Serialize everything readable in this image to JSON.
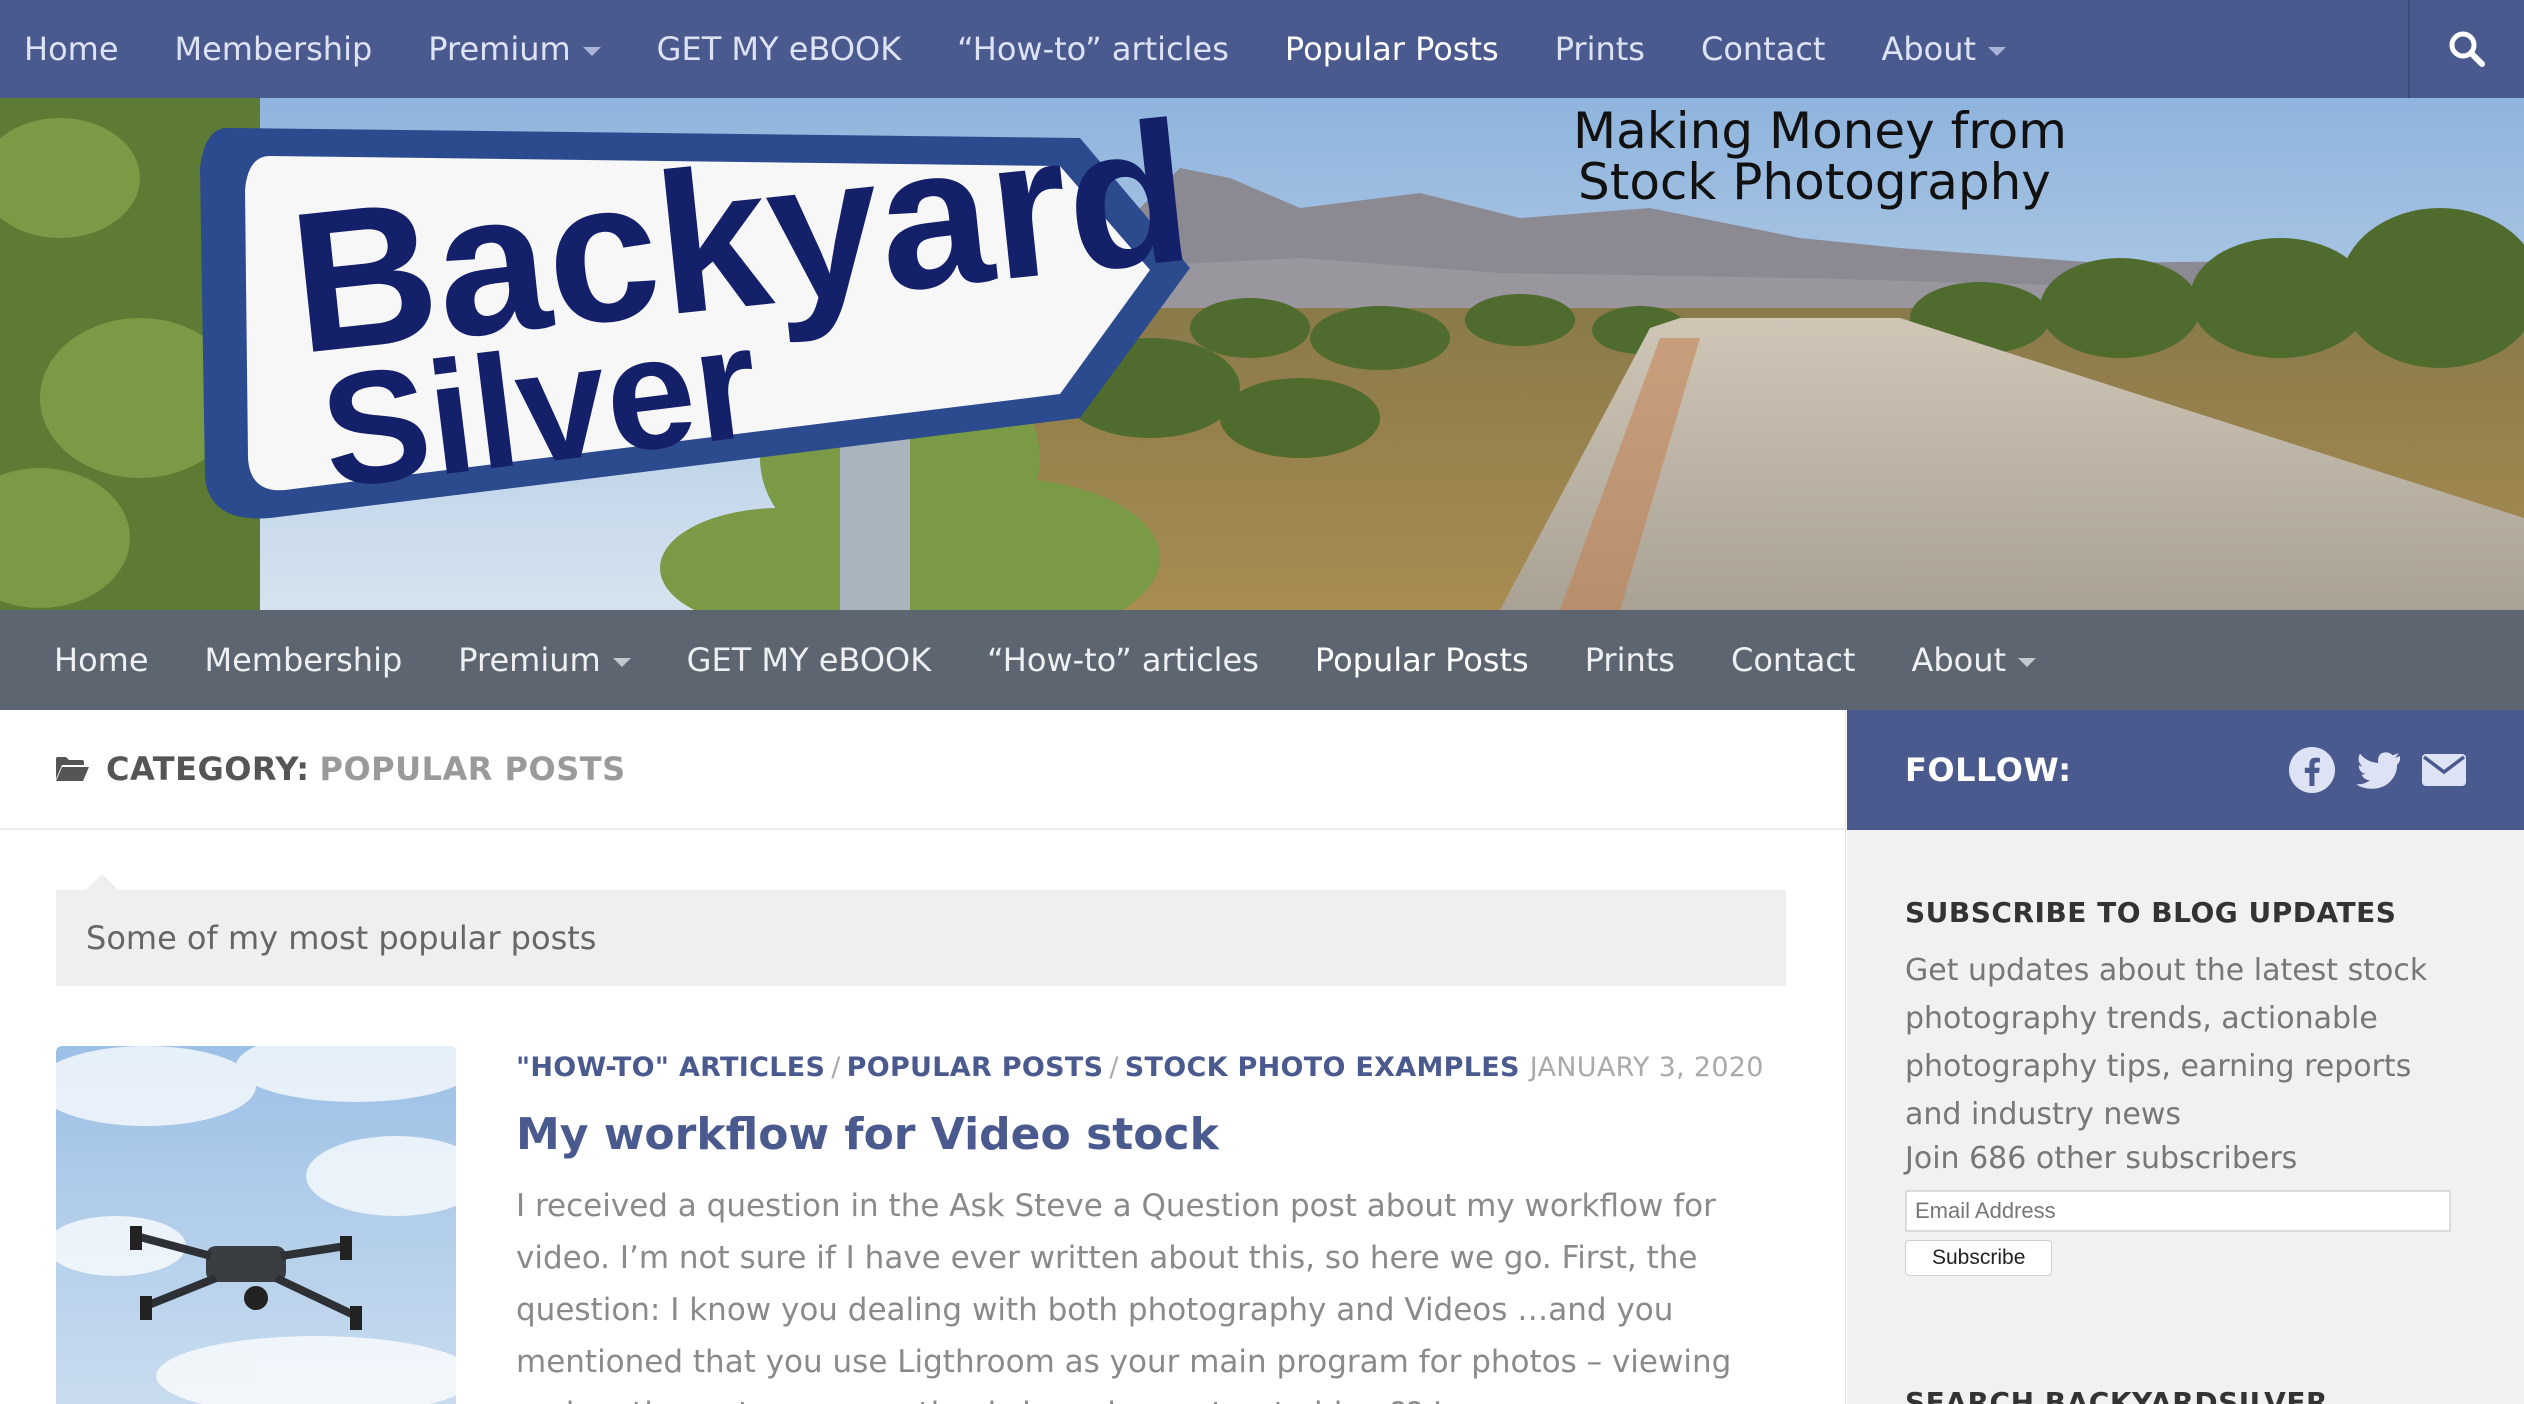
{
  "top_nav": {
    "items": [
      {
        "label": "Home",
        "has_dropdown": false
      },
      {
        "label": "Membership",
        "has_dropdown": false
      },
      {
        "label": "Premium",
        "has_dropdown": true
      },
      {
        "label": "GET MY eBOOK",
        "has_dropdown": false
      },
      {
        "label": "“How-to” articles",
        "has_dropdown": false
      },
      {
        "label": "Popular Posts",
        "has_dropdown": false,
        "active": true
      },
      {
        "label": "Prints",
        "has_dropdown": false
      },
      {
        "label": "Contact",
        "has_dropdown": false
      },
      {
        "label": "About",
        "has_dropdown": true
      }
    ],
    "search_icon": "search-icon"
  },
  "banner": {
    "logo_line1": "Backyard",
    "logo_line2": "Silver",
    "tagline_line1": "Making Money from",
    "tagline_line2": "Stock Photography"
  },
  "sub_nav": {
    "items": [
      {
        "label": "Home",
        "has_dropdown": false
      },
      {
        "label": "Membership",
        "has_dropdown": false
      },
      {
        "label": "Premium",
        "has_dropdown": true
      },
      {
        "label": "GET MY eBOOK",
        "has_dropdown": false
      },
      {
        "label": "“How-to” articles",
        "has_dropdown": false
      },
      {
        "label": "Popular Posts",
        "has_dropdown": false,
        "active": true
      },
      {
        "label": "Prints",
        "has_dropdown": false
      },
      {
        "label": "Contact",
        "has_dropdown": false
      },
      {
        "label": "About",
        "has_dropdown": true
      }
    ]
  },
  "category": {
    "icon": "folder-open-icon",
    "label": "CATEGORY:",
    "value": "POPULAR POSTS",
    "description": "Some of my most popular posts"
  },
  "post": {
    "categories": [
      "\"HOW-TO\" ARTICLES",
      "POPULAR POSTS",
      "STOCK PHOTO EXAMPLES"
    ],
    "separator": "/",
    "date": "JANUARY 3, 2020",
    "title": "My workflow for Video stock",
    "excerpt": "I received a question in the Ask Steve a Question post about my workflow for video. I’m not sure if I have ever written about this, so here we go. First, the question: I know you dealing with both photography and Videos …and you mentioned that you use Ligthroom as your main program for photos – viewing and sorting ect – my question is how do you treat video ?? I",
    "thumbnail_icon": "drone-photo"
  },
  "sidebar": {
    "follow_label": "FOLLOW:",
    "social_icons": [
      "facebook-icon",
      "twitter-icon",
      "email-icon"
    ],
    "subscribe": {
      "title": "SUBSCRIBE TO BLOG UPDATES",
      "text": "Get updates about the latest stock photography trends, actionable photography tips, earning reports and industry news",
      "join": "Join 686 other subscribers",
      "email_placeholder": "Email Address",
      "button": "Subscribe"
    },
    "search_title": "SEARCH BACKYARDSILVER"
  },
  "colors": {
    "nav_blue": "#4b5a8e",
    "nav_grey": "#5d6670",
    "sidebar_bg": "#f1f1f1"
  }
}
